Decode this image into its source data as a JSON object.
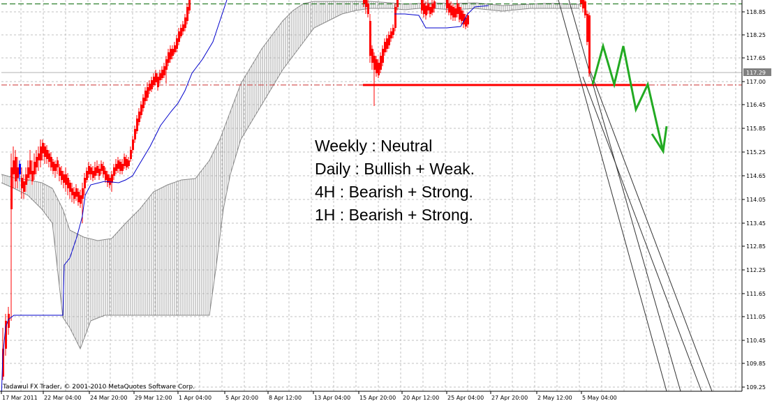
{
  "chart_data": {
    "type": "candlestick",
    "watermark": "Tadawul FX Trader, © 2001-2010 MetaQuotes Software Corp.",
    "y_axis": {
      "min": 109.25,
      "max": 119.15,
      "ticks": [
        "118.85",
        "118.25",
        "117.65",
        "117.00",
        "116.45",
        "115.85",
        "115.25",
        "114.65",
        "114.05",
        "113.45",
        "112.85",
        "112.25",
        "111.65",
        "111.05",
        "110.45",
        "109.85",
        "109.25"
      ]
    },
    "x_axis": {
      "ticks": [
        "17 Mar 2011",
        "22 Mar 04:00",
        "24 Mar 20:00",
        "29 Mar 12:00",
        "1 Apr 04:00",
        "5 Apr 20:00",
        "8 Apr 12:00",
        "13 Apr 04:00",
        "15 Apr 20:00",
        "20 Apr 12:00",
        "25 Apr 04:00",
        "27 Apr 20:00",
        "2 May 12:00",
        "5 May 04:00"
      ]
    },
    "current_price": "117.29",
    "support_level": 117.0,
    "resistance_level": 119.05,
    "annotations": [
      "Weekly : Neutral",
      "Daily : Bullish + Weak.",
      "4H : Bearish + Strong.",
      "1H : Bearish + Strong."
    ],
    "forecast_path": [
      [
        849,
        121
      ],
      [
        864,
        66
      ],
      [
        880,
        121
      ],
      [
        893,
        66
      ],
      [
        911,
        157
      ],
      [
        928,
        121
      ],
      [
        950,
        217
      ]
    ],
    "colors": {
      "up_candle": "#0000ff",
      "down_candle": "#ff0000",
      "kijun_line": "#0000cc",
      "cloud": "#a0a0a0",
      "grid": "#c0c0c0",
      "support_line": "#ff0000",
      "resistance_line": "#006600",
      "forecast": "#22aa22",
      "price_tag": "#808080"
    }
  }
}
